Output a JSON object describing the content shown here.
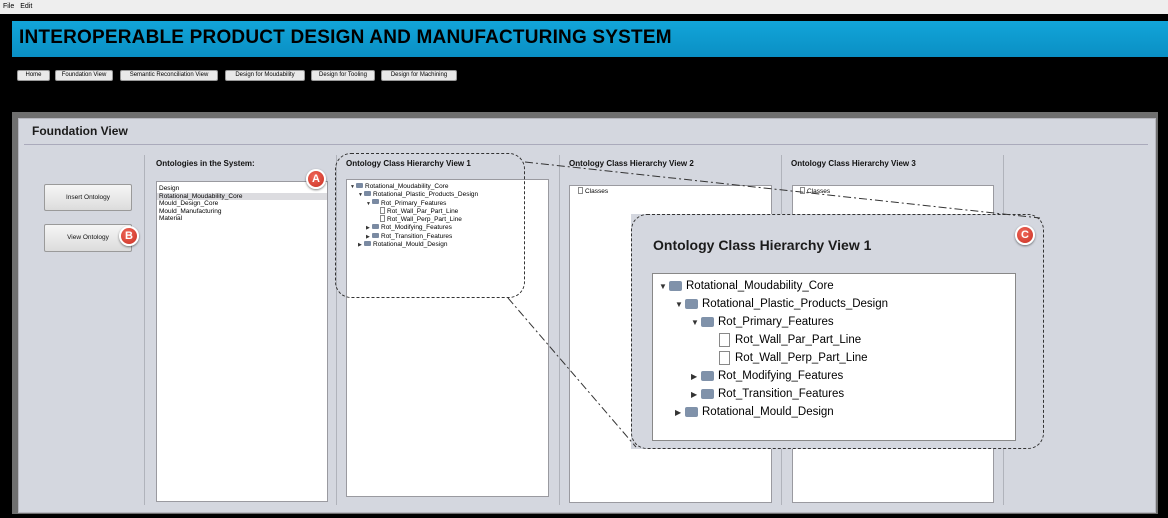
{
  "menu": [
    "File",
    "Edit"
  ],
  "app_title": "INTEROPERABLE PRODUCT DESIGN AND MANUFACTURING SYSTEM",
  "nav": [
    "Home",
    "Foundation View",
    "Semantic Reconciliation View",
    "Design for Moudability",
    "Design for Tooling",
    "Design for Machining"
  ],
  "panel_title": "Foundation View",
  "buttons": {
    "insert": "Insert Ontology",
    "view": "View Ontology"
  },
  "ontologies": {
    "header": "Ontologies in the System:",
    "items": [
      "Design",
      "Rotational_Moudability_Core",
      "Mould_Design_Core",
      "Mould_Manufacturing",
      "Material"
    ],
    "selected": "Rotational_Moudability_Core"
  },
  "hierarchy": {
    "view1_header": "Ontology Class Hierarchy View 1",
    "view2_header": "Ontology Class Hierarchy View 2",
    "view3_header": "Ontology Class Hierarchy View 3",
    "view2_root": "Classes",
    "view3_root": "Classes",
    "tree": [
      {
        "label": "Rotational_Moudability_Core",
        "level": 0,
        "type": "folder",
        "expanded": true
      },
      {
        "label": "Rotational_Plastic_Products_Design",
        "level": 1,
        "type": "folder",
        "expanded": true
      },
      {
        "label": "Rot_Primary_Features",
        "level": 2,
        "type": "folder",
        "expanded": true
      },
      {
        "label": "Rot_Wall_Par_Part_Line",
        "level": 3,
        "type": "file"
      },
      {
        "label": "Rot_Wall_Perp_Part_Line",
        "level": 3,
        "type": "file"
      },
      {
        "label": "Rot_Modifying_Features",
        "level": 2,
        "type": "folder",
        "expanded": false
      },
      {
        "label": "Rot_Transition_Features",
        "level": 2,
        "type": "folder",
        "expanded": false
      },
      {
        "label": "Rotational_Mould_Design",
        "level": 1,
        "type": "folder",
        "expanded": false
      }
    ]
  },
  "callouts": [
    "A",
    "B",
    "C"
  ],
  "colors": {
    "banner": "#0a9bd0",
    "panel": "#d4d7df",
    "badge": "#d9392b"
  }
}
